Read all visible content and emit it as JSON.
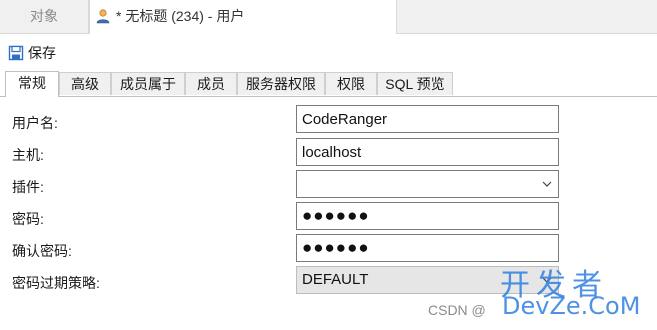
{
  "doc_tabs": {
    "objects_label": "对象",
    "active_label": "* 无标题 (234) - 用户"
  },
  "toolbar": {
    "save_label": "保存"
  },
  "prop_tabs": [
    "常规",
    "高级",
    "成员属于",
    "成员",
    "服务器权限",
    "权限",
    "SQL 预览"
  ],
  "active_prop_tab": "常规",
  "form": {
    "username_label": "用户名:",
    "username_value": "CodeRanger",
    "host_label": "主机:",
    "host_value": "localhost",
    "plugin_label": "插件:",
    "plugin_value": "",
    "password_label": "密码:",
    "password_value": "●●●●●●",
    "confirm_label": "确认密码:",
    "confirm_value": "●●●●●●",
    "expire_label": "密码过期策略:",
    "expire_value": "DEFAULT"
  },
  "watermark": {
    "csdn_text": "CSDN @",
    "big_text": "开发者",
    "brand_text": "DevZe.CoM"
  },
  "colors": {
    "accent": "#2f7fe0",
    "tab_bg": "#f0f0f0",
    "field_border": "#7a7a7a"
  }
}
